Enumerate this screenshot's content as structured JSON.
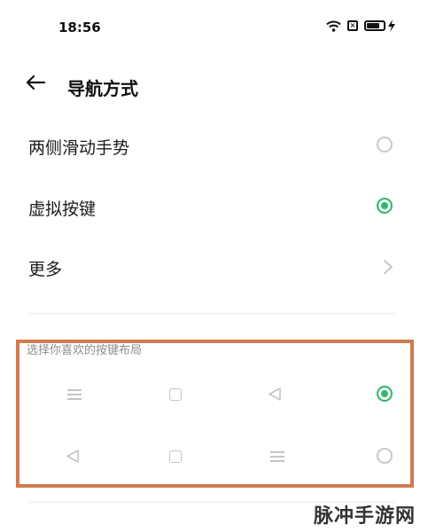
{
  "status_bar": {
    "time": "18:56",
    "icons": [
      "wifi-icon",
      "sim-x-icon",
      "battery-charging-icon"
    ]
  },
  "header": {
    "back_icon": "arrow-left-icon",
    "title": "导航方式"
  },
  "options": [
    {
      "label": "两侧滑动手势",
      "selected": false
    },
    {
      "label": "虚拟按键",
      "selected": true
    },
    {
      "label": "更多",
      "type": "link"
    }
  ],
  "layout_section": {
    "label": "选择你喜欢的按键布局",
    "layouts": [
      {
        "keys": [
          "menu-icon",
          "square-icon",
          "back-triangle-icon"
        ],
        "selected": true
      },
      {
        "keys": [
          "back-triangle-icon",
          "square-icon",
          "menu-icon"
        ],
        "selected": false
      }
    ]
  },
  "watermark": "脉冲手游网",
  "colors": {
    "accent": "#2fb86c",
    "highlight_border": "#d07c4f"
  }
}
